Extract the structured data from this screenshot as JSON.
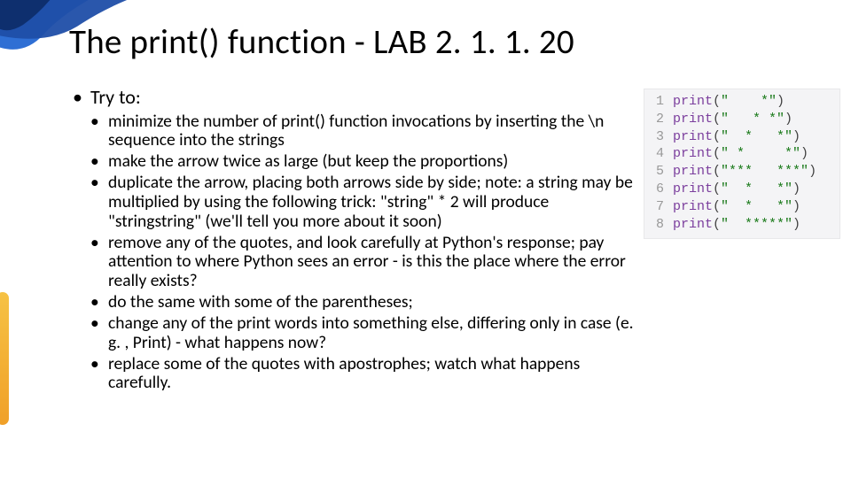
{
  "title": "The print() function - LAB 2. 1. 1. 20",
  "intro": "Try to:",
  "bullets": [
    "minimize the number of print() function invocations by inserting the \\n sequence into the strings",
    "make the arrow twice as large (but keep the proportions)",
    "duplicate the arrow, placing both arrows side by side; note: a string may be multiplied by using the following trick: \"string\" * 2 will produce \"stringstring\" (we'll tell you more about it soon)",
    "remove any of the quotes, and look carefully at Python's response; pay attention to where Python sees an error - is this the place where the error really exists?",
    "do the same with some of the parentheses;",
    "change any of the print words into something else, differing only in case (e. g. , Print) - what happens now?",
    "replace some of the quotes with apostrophes; watch what happens carefully."
  ],
  "code": [
    {
      "n": "1",
      "arg": "\"    *\""
    },
    {
      "n": "2",
      "arg": "\"   * *\""
    },
    {
      "n": "3",
      "arg": "\"  *   *\""
    },
    {
      "n": "4",
      "arg": "\" *     *\""
    },
    {
      "n": "5",
      "arg": "\"***   ***\""
    },
    {
      "n": "6",
      "arg": "\"  *   *\""
    },
    {
      "n": "7",
      "arg": "\"  *   *\""
    },
    {
      "n": "8",
      "arg": "\"  *****\""
    }
  ],
  "fn_name": "print",
  "paren_open": "(",
  "paren_close": ")"
}
